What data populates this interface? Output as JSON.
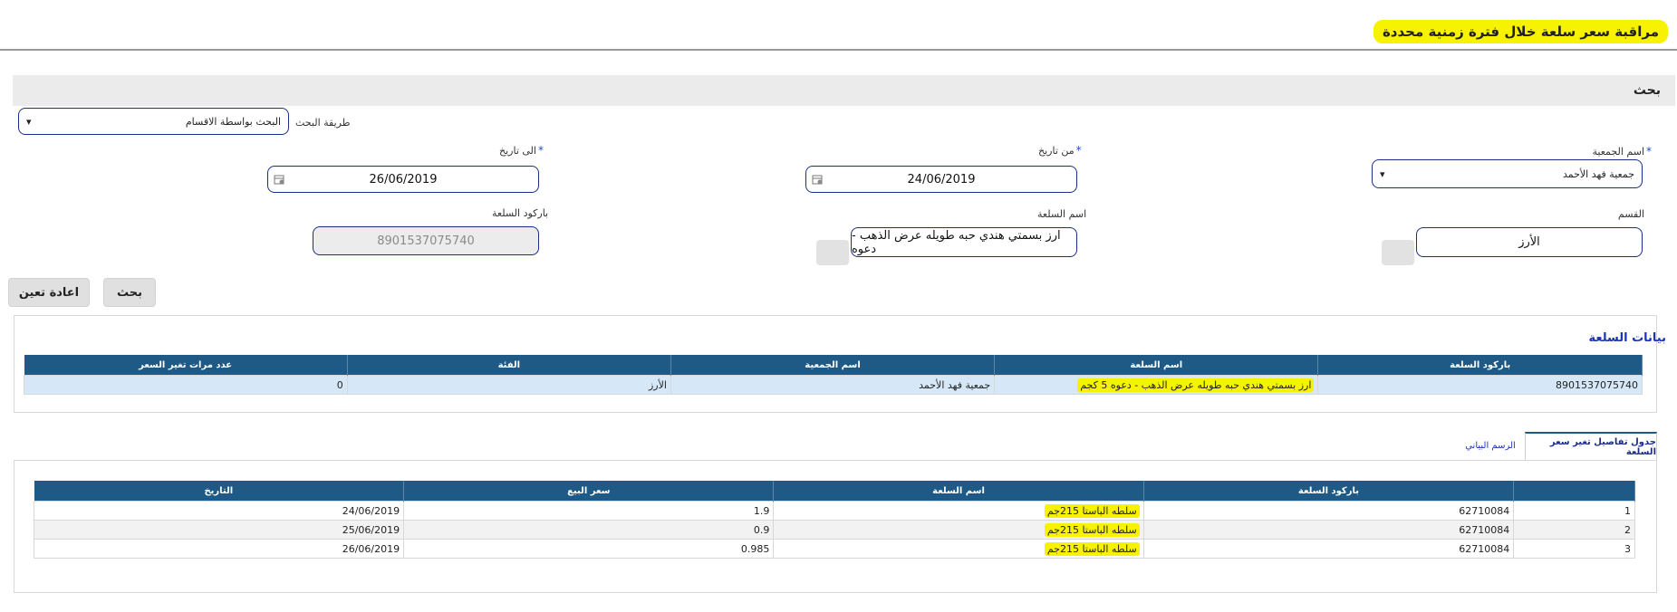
{
  "page": {
    "title": "مراقبة سعر سلعة خلال فترة زمنية محددة"
  },
  "search": {
    "section_title": "بحث",
    "method_label": "طريقة البحث",
    "method_value": "البحث بواسطة الاقسام",
    "society_label": "اسم الجمعية",
    "society_value": "جمعية فهد الأحمد",
    "from_label": "من تاريخ",
    "from_value": "24/06/2019",
    "to_label": "الى تاريخ",
    "to_value": "26/06/2019",
    "category_label": "القسم",
    "category_value": "الأرز",
    "product_label": "اسم السلعة",
    "product_value": "ارز بسمتي هندي حبه طويله عرض الذهب - دعوه",
    "barcode_label": "باركود السلعة",
    "barcode_value": "8901537075740",
    "required_mark": "*",
    "search_button": "بحث",
    "reset_button": "اعادة تعين"
  },
  "product_data": {
    "section_title": "بيانات السلعة",
    "headers": [
      "باركود السلعة",
      "اسم السلعة",
      "اسم الجمعية",
      "الفئة",
      "عدد مرات تغير السعر"
    ],
    "row": [
      "8901537075740",
      "ارز بسمتي هندي حبه طويله عرض الذهب - دعوه 5 كجم",
      "جمعية فهد الأحمد",
      "الأرز",
      "0"
    ]
  },
  "tabs": {
    "active": "جدول تفاصيل تغير سعر السلعة",
    "inactive": "الرسم البياني"
  },
  "details": {
    "headers": [
      "",
      "باركود السلعة",
      "اسم السلعة",
      "سعر البيع",
      "التاريخ"
    ],
    "rows": [
      [
        "1",
        "62710084",
        "سلطه الباستا 215جم",
        "1.9",
        "24/06/2019"
      ],
      [
        "2",
        "62710084",
        "سلطه الباستا 215جم",
        "0.9",
        "25/06/2019"
      ],
      [
        "3",
        "62710084",
        "سلطه الباستا 215جم",
        "0.985",
        "26/06/2019"
      ]
    ]
  },
  "colors": {
    "highlight": "#f6f200",
    "table_header": "#1f5a86",
    "field_border": "#1a2e8a"
  }
}
